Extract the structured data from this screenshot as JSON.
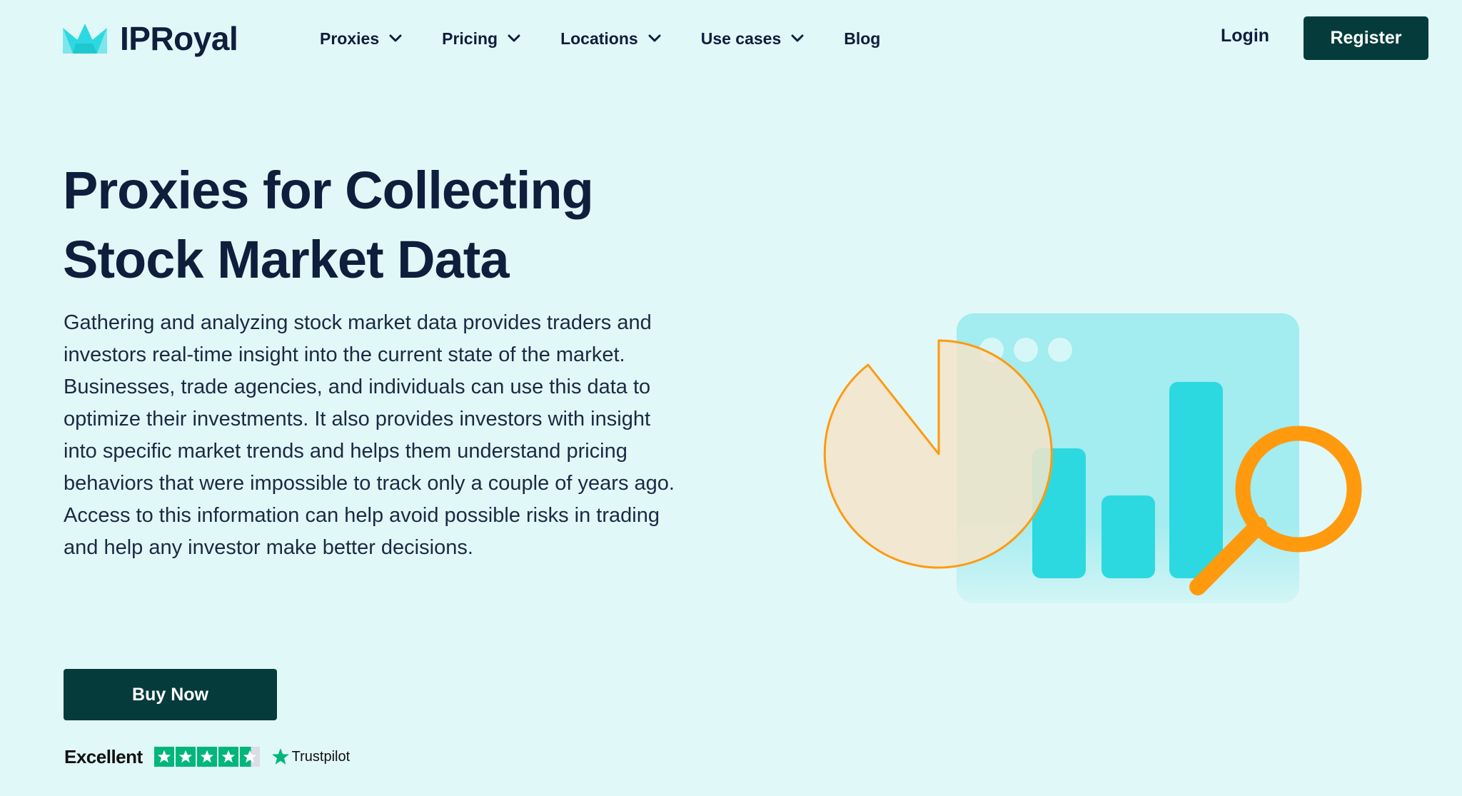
{
  "brand": {
    "name": "IPRoyal",
    "color": "#2dd9e0"
  },
  "nav": {
    "items": [
      {
        "label": "Proxies",
        "dropdown": true
      },
      {
        "label": "Pricing",
        "dropdown": true
      },
      {
        "label": "Locations",
        "dropdown": true
      },
      {
        "label": "Use cases",
        "dropdown": true
      },
      {
        "label": "Blog",
        "dropdown": false
      }
    ],
    "login_label": "Login",
    "register_label": "Register"
  },
  "hero": {
    "title_line1": "Proxies for Collecting",
    "title_line2": "Stock Market Data",
    "body": "Gathering and analyzing stock market data provides traders and investors real-time insight into the current state of the market. Businesses, trade agencies, and individuals can use this data to optimize their investments. It also provides investors with insight into specific market trends and helps them understand pricing behaviors that were impossible to track only a couple of years ago. Access to this information can help avoid possible risks in trading and help any investor make better decisions.",
    "cta_label": "Buy Now"
  },
  "rating": {
    "label": "Excellent",
    "stars": 4.5,
    "provider": "Trustpilot",
    "star_color": "#00b67a"
  },
  "colors": {
    "background": "#e1f8f8",
    "primary_button": "#063b3b",
    "text": "#0d1f3c",
    "accent_orange": "#ff9a0f",
    "accent_cyan": "#2dd9e0"
  }
}
